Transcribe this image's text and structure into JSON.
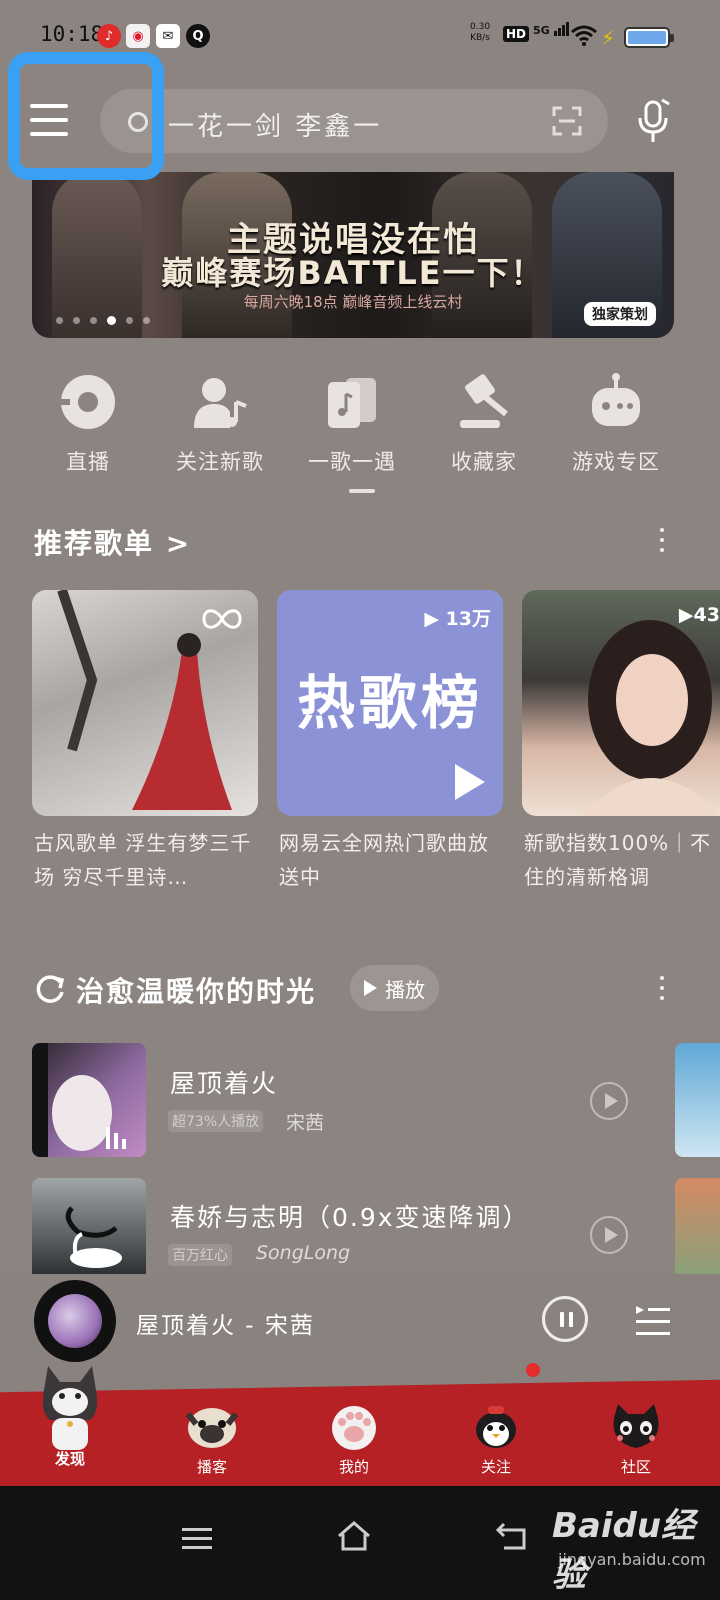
{
  "status_bar": {
    "time": "10:18",
    "net_speed_value": "0.30",
    "net_speed_unit": "KB/s",
    "hd": "HD",
    "signal": "5G",
    "apps": [
      "netease-music-icon",
      "weibo-icon",
      "mail-icon",
      "q-icon"
    ]
  },
  "search": {
    "placeholder": "一花一剑 李鑫一"
  },
  "banner": {
    "title_line1": "主题说唱没在怕",
    "title_line2": "巅峰赛场BATTLE一下！",
    "subtitle": "每周六晚18点 巅峰音频上线云村",
    "tag": "独家策划",
    "page_count": 6,
    "active_index": 3
  },
  "quick_nav": [
    {
      "label": "直播",
      "icon": "live-disc-icon"
    },
    {
      "label": "关注新歌",
      "icon": "person-note-icon"
    },
    {
      "label": "一歌一遇",
      "icon": "cards-note-icon"
    },
    {
      "label": "收藏家",
      "icon": "hammer-icon"
    },
    {
      "label": "游戏专区",
      "icon": "game-robot-icon"
    }
  ],
  "recommend": {
    "title": "推荐歌单 >",
    "playlists": [
      {
        "title": "古风歌单 浮生有梦三千场 穷尽千里诗…",
        "count": "",
        "badge": "infinity-icon"
      },
      {
        "title": "网易云全网热门歌曲放送中",
        "count": "13万",
        "cover_text": "热歌榜"
      },
      {
        "title": "新歌指数100%｜不住的清新格调",
        "count": "43"
      }
    ]
  },
  "healing": {
    "title": "治愈温暖你的时光",
    "play_label": "播放",
    "songs": [
      {
        "title": "屋顶着火",
        "tag": "超73%人播放",
        "artist": "宋茜"
      },
      {
        "title": "春娇与志明（0.9x变速降调）",
        "tag": "百万红心",
        "artist": "SongLong"
      }
    ]
  },
  "now_playing": {
    "text": "屋顶着火 - 宋茜"
  },
  "tabs": [
    {
      "label": "发现",
      "icon": "cat-icon"
    },
    {
      "label": "播客",
      "icon": "pug-icon"
    },
    {
      "label": "我的",
      "icon": "paw-icon"
    },
    {
      "label": "关注",
      "icon": "penguin-icon"
    },
    {
      "label": "社区",
      "icon": "black-cat-icon"
    }
  ],
  "watermark": {
    "logo": "Baidu经验",
    "url": "jingyan.baidu.com"
  },
  "colors": {
    "accent_highlight": "#3aa0f4",
    "bottom_nav": "#b52124",
    "background": "#8c8480",
    "hot_chart_card": "#8b92d6"
  }
}
